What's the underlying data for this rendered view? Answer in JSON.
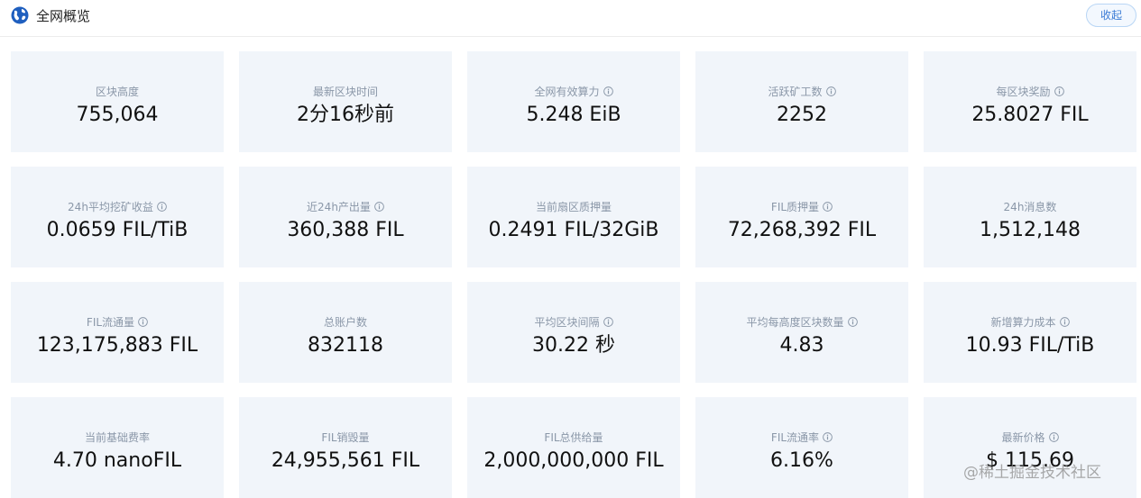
{
  "header": {
    "title": "全网概览",
    "collapse_label": "收起"
  },
  "colors": {
    "card_bg": "#f1f5fa",
    "label": "#8a97a8",
    "value": "#111111",
    "accent": "#3a7bd5"
  },
  "cards": [
    {
      "label": "区块高度",
      "value": "755,064",
      "info": false
    },
    {
      "label": "最新区块时间",
      "value": "2分16秒前",
      "info": false
    },
    {
      "label": "全网有效算力",
      "value": "5.248 EiB",
      "info": true
    },
    {
      "label": "活跃矿工数",
      "value": "2252",
      "info": true
    },
    {
      "label": "每区块奖励",
      "value": "25.8027 FIL",
      "info": true
    },
    {
      "label": "24h平均挖矿收益",
      "value": "0.0659 FIL/TiB",
      "info": true
    },
    {
      "label": "近24h产出量",
      "value": "360,388 FIL",
      "info": true
    },
    {
      "label": "当前扇区质押量",
      "value": "0.2491 FIL/32GiB",
      "info": false
    },
    {
      "label": "FIL质押量",
      "value": "72,268,392 FIL",
      "info": true
    },
    {
      "label": "24h消息数",
      "value": "1,512,148",
      "info": false
    },
    {
      "label": "FIL流通量",
      "value": "123,175,883 FIL",
      "info": true
    },
    {
      "label": "总账户数",
      "value": "832118",
      "info": false
    },
    {
      "label": "平均区块间隔",
      "value": "30.22 秒",
      "info": true
    },
    {
      "label": "平均每高度区块数量",
      "value": "4.83",
      "info": true
    },
    {
      "label": "新增算力成本",
      "value": "10.93 FIL/TiB",
      "info": true
    },
    {
      "label": "当前基础费率",
      "value": "4.70 nanoFIL",
      "info": false
    },
    {
      "label": "FIL销毁量",
      "value": "24,955,561 FIL",
      "info": false
    },
    {
      "label": "FIL总供给量",
      "value": "2,000,000,000 FIL",
      "info": false
    },
    {
      "label": "FIL流通率",
      "value": "6.16%",
      "info": true
    },
    {
      "label": "最新价格",
      "value": "$ 115.69",
      "info": true
    }
  ],
  "watermark": "@稀土掘金技术社区"
}
